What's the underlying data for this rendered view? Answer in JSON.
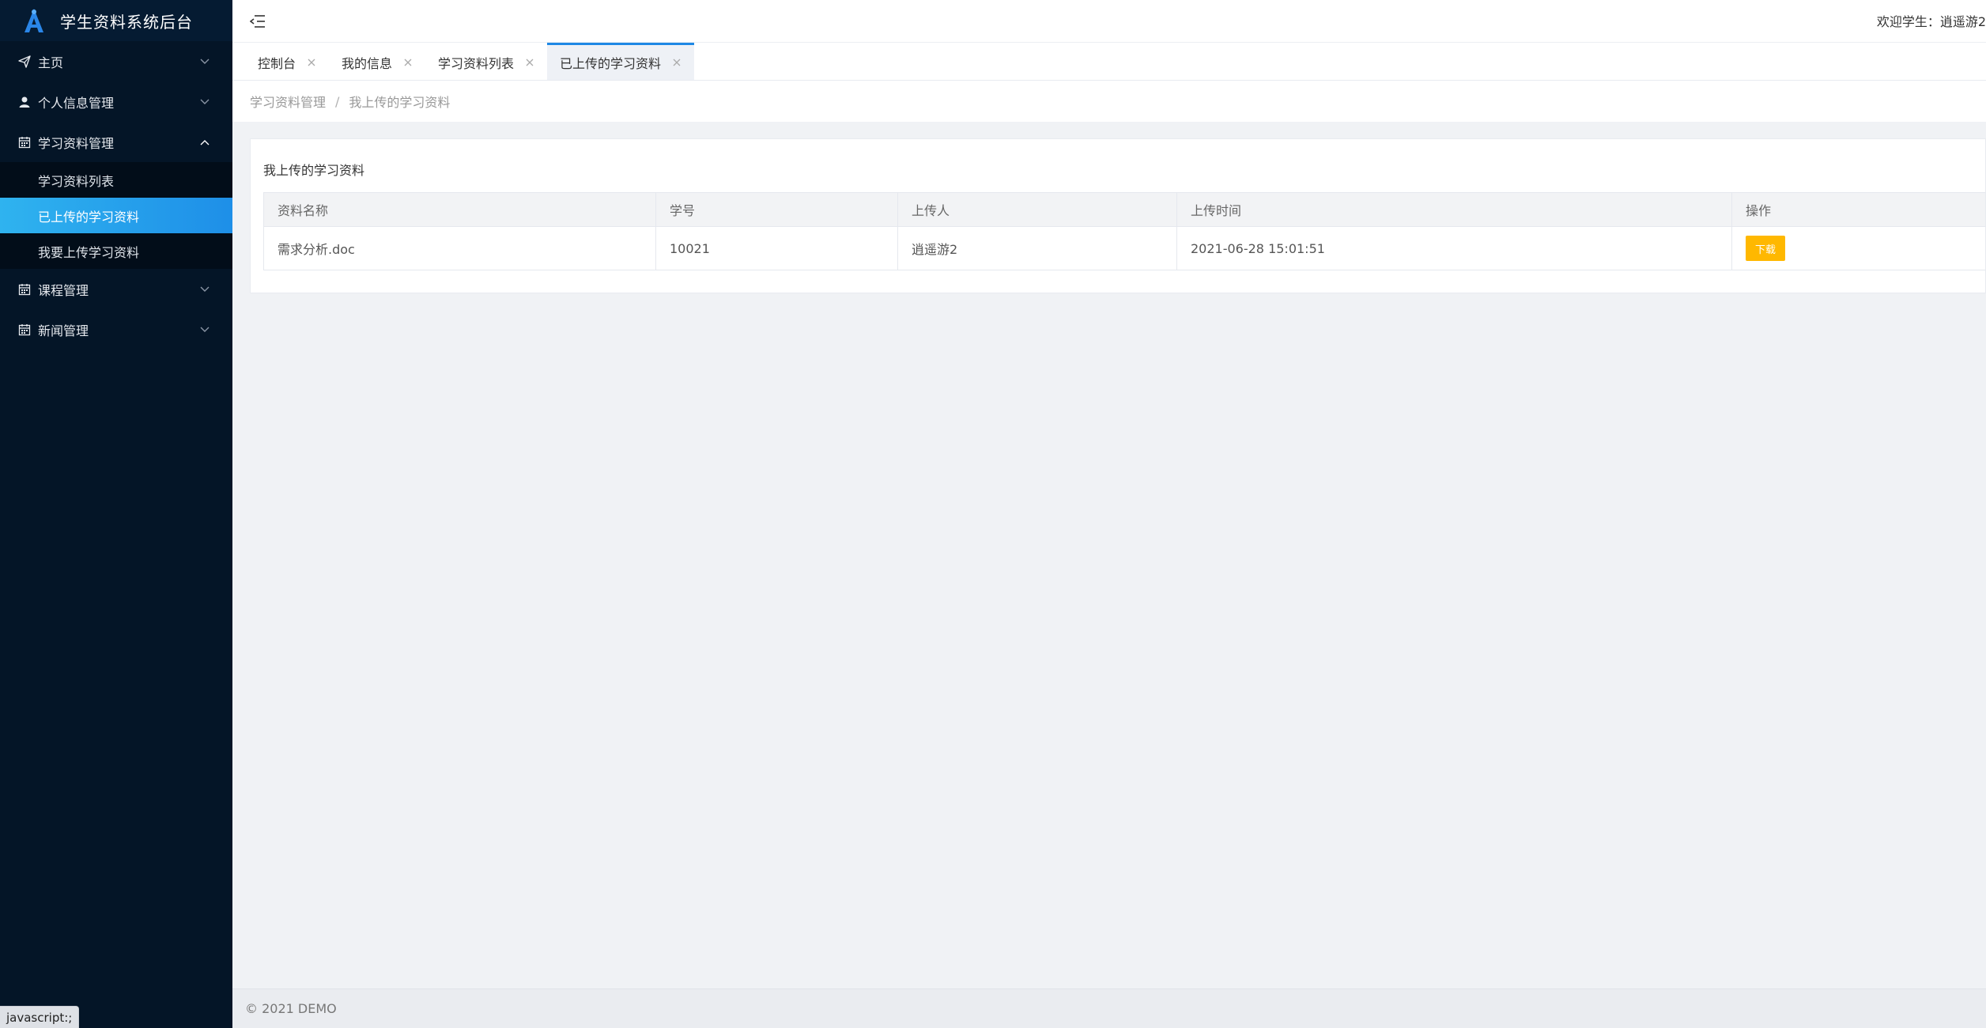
{
  "app": {
    "title": "学生资料系统后台"
  },
  "header": {
    "welcome": "欢迎学生：逍遥游2"
  },
  "sidebar": {
    "items": [
      {
        "label": "主页",
        "icon": "paper-plane-icon"
      },
      {
        "label": "个人信息管理",
        "icon": "user-icon"
      },
      {
        "label": "学习资料管理",
        "icon": "calendar-icon",
        "expanded": true,
        "children": [
          {
            "label": "学习资料列表"
          },
          {
            "label": "已上传的学习资料",
            "active": true
          },
          {
            "label": "我要上传学习资料"
          }
        ]
      },
      {
        "label": "课程管理",
        "icon": "calendar-icon"
      },
      {
        "label": "新闻管理",
        "icon": "calendar-icon"
      }
    ]
  },
  "tabs": [
    {
      "label": "控制台"
    },
    {
      "label": "我的信息"
    },
    {
      "label": "学习资料列表"
    },
    {
      "label": "已上传的学习资料",
      "active": true
    }
  ],
  "breadcrumb": [
    "学习资料管理",
    "我上传的学习资料"
  ],
  "breadcrumb_sep": "/",
  "card": {
    "title": "我上传的学习资料"
  },
  "table": {
    "headers": [
      "资料名称",
      "学号",
      "上传人",
      "上传时间",
      "操作"
    ],
    "rows": [
      {
        "name": "需求分析.doc",
        "student_id": "10021",
        "uploader": "逍遥游2",
        "time": "2021-06-28 15:01:51",
        "action": "下载"
      }
    ]
  },
  "footer": {
    "text": "© 2021 DEMO"
  },
  "status_bar": {
    "url": "javascript:;"
  },
  "colors": {
    "sidebar_bg": "#041527",
    "active_item": "#1e8fe8",
    "tab_accent": "#1e88e5",
    "download_button": "#ffb800"
  }
}
